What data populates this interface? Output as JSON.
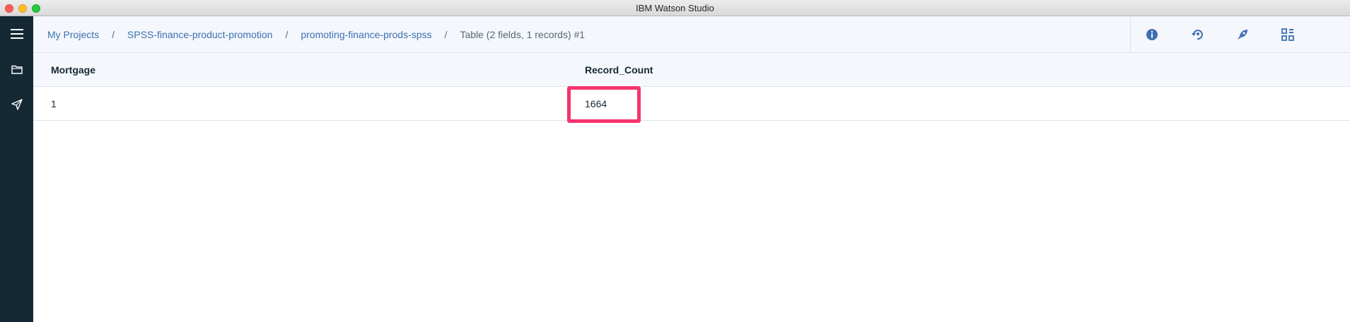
{
  "window": {
    "title": "IBM Watson Studio"
  },
  "breadcrumb": {
    "items": [
      "My Projects",
      "SPSS-finance-product-promotion",
      "promoting-finance-prods-spss"
    ],
    "separator": "/",
    "current": "Table (2 fields, 1 records) #1"
  },
  "toolbar": {
    "icons": [
      "info-icon",
      "restore-icon",
      "rocket-icon",
      "grid-icon"
    ]
  },
  "rail": {
    "icons": [
      "hamburger-menu-icon",
      "folder-icon",
      "rocket-icon"
    ]
  },
  "table": {
    "columns": [
      "Mortgage",
      "Record_Count"
    ],
    "rows": [
      [
        "1",
        "1664"
      ]
    ],
    "highlighted_cell": {
      "row": 0,
      "column": 1,
      "color": "#f7346c"
    }
  },
  "colors": {
    "accent": "#3d70b2",
    "rail": "#152935",
    "header_bg": "#f4f7fb"
  }
}
